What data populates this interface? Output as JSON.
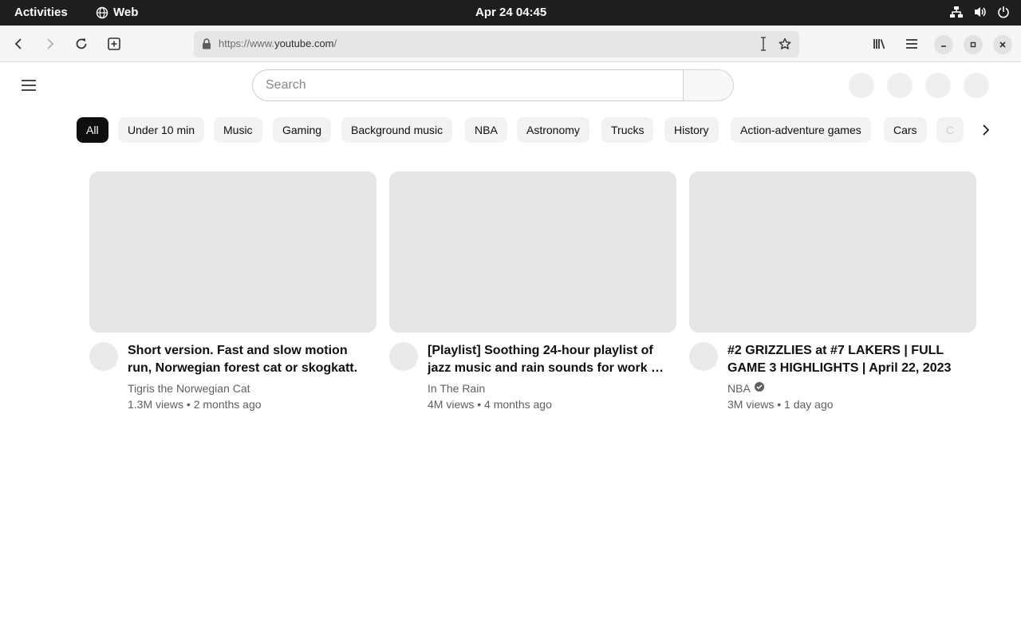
{
  "system_bar": {
    "activities": "Activities",
    "app_name": "Web",
    "clock": "Apr 24  04:45"
  },
  "browser": {
    "url_prefix": "https://www.",
    "url_host": "youtube.com",
    "url_suffix": "/"
  },
  "youtube": {
    "search_placeholder": "Search",
    "chips": [
      {
        "label": "All"
      },
      {
        "label": "Under 10 min"
      },
      {
        "label": "Music"
      },
      {
        "label": "Gaming"
      },
      {
        "label": "Background music"
      },
      {
        "label": "NBA"
      },
      {
        "label": "Astronomy"
      },
      {
        "label": "Trucks"
      },
      {
        "label": "History"
      },
      {
        "label": "Action-adventure games"
      },
      {
        "label": "Cars"
      },
      {
        "label": "C"
      }
    ],
    "videos": [
      {
        "title": "Short version. Fast and slow motion run, Norwegian forest cat or skogkatt. …",
        "channel": "Tigris the Norwegian Cat",
        "stats": "1.3M views • 2 months ago",
        "verified": false
      },
      {
        "title": "[Playlist] Soothing 24-hour playlist of jazz music and rain sounds for work …",
        "channel": "In The Rain",
        "stats": "4M views • 4 months ago",
        "verified": false
      },
      {
        "title": "#2 GRIZZLIES at #7 LAKERS | FULL GAME 3 HIGHLIGHTS | April 22, 2023",
        "channel": "NBA",
        "stats": "3M views • 1 day ago",
        "verified": true
      }
    ]
  }
}
